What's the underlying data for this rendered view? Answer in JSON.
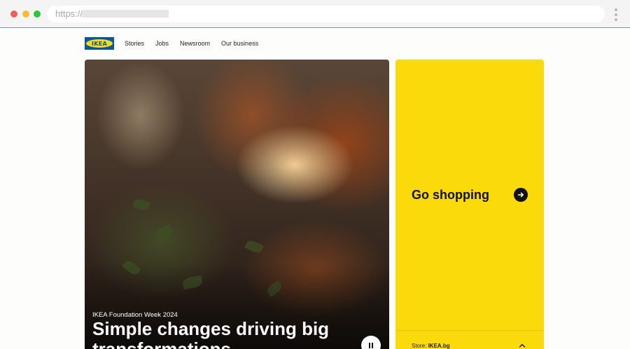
{
  "browser": {
    "url_scheme": "https://"
  },
  "brand": {
    "logo_text": "IKEA",
    "colors": {
      "blue": "#0058a3",
      "yellow": "#fbd914"
    }
  },
  "nav": {
    "items": [
      {
        "label": "Stories"
      },
      {
        "label": "Jobs"
      },
      {
        "label": "Newsroom"
      },
      {
        "label": "Our business"
      }
    ]
  },
  "hero": {
    "kicker": "IKEA Foundation Week 2024",
    "title": "Simple changes driving big transformations",
    "pause_icon": "pause-icon"
  },
  "shop_panel": {
    "label": "Go shopping",
    "arrow_icon": "arrow-right-icon",
    "store_prefix": "Store: ",
    "store_name": "IKEA.bg",
    "toggle_icon": "chevron-up-icon",
    "background": "#fbda0c"
  }
}
